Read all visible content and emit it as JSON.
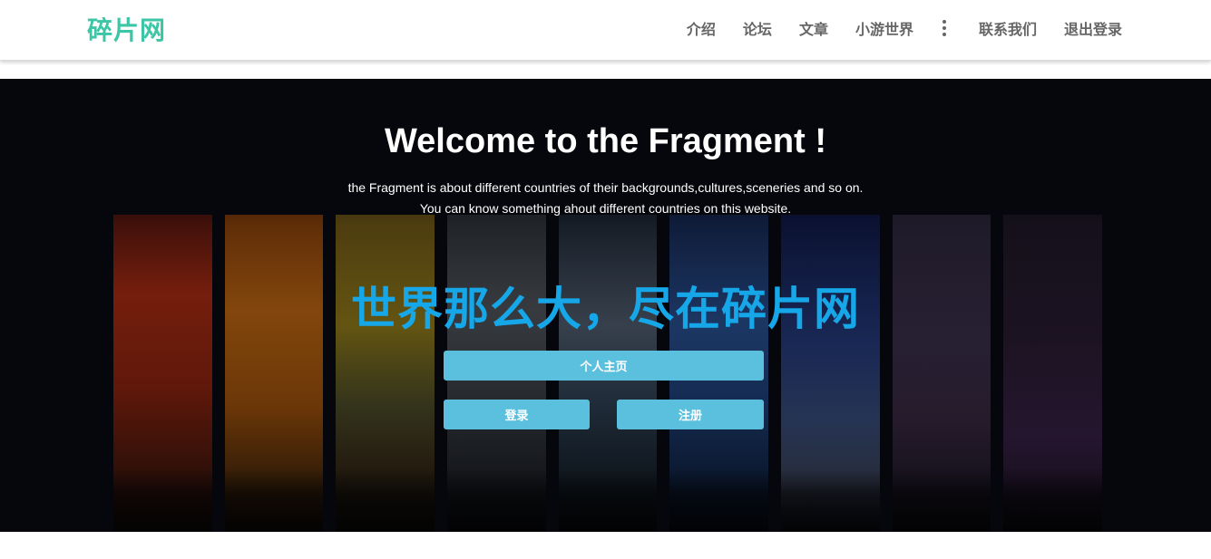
{
  "navbar": {
    "brand": "碎片网",
    "items": [
      {
        "label": "介绍"
      },
      {
        "label": "论坛"
      },
      {
        "label": "文章"
      },
      {
        "label": "小游世界"
      }
    ],
    "more_icon": "kebab-vertical-icon",
    "right_items": [
      {
        "label": "联系我们"
      },
      {
        "label": "退出登录"
      }
    ]
  },
  "hero": {
    "title": "Welcome to the Fragment !",
    "subtitle_line1": "the Fragment is about different countries of their backgrounds,cultures,sceneries and so on.",
    "subtitle_line2": "You can know something ahout different countries on this website.",
    "slogan": "世界那么大，尽在碎片网",
    "buttons": {
      "home": "个人主页",
      "login": "登录",
      "register": "注册"
    }
  },
  "colors": {
    "brand": "#3cc6a6",
    "slogan": "#16a7e8",
    "button": "#5bc0de",
    "nav_text": "#666666"
  }
}
